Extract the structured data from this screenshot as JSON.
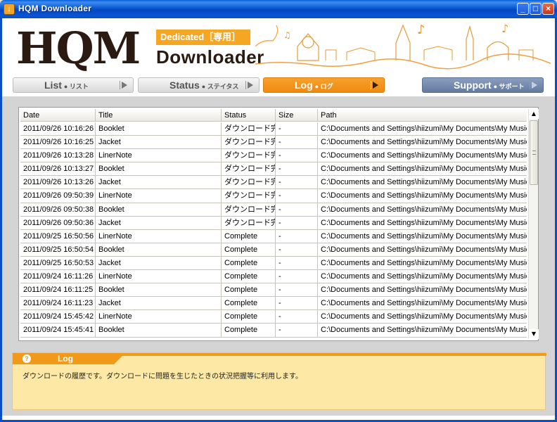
{
  "window": {
    "title": "HQM Downloader",
    "app_icon_glyph": "↓",
    "minimize_glyph": "_",
    "maximize_glyph": "□",
    "close_glyph": "×"
  },
  "header": {
    "logo": "HQM",
    "badge": "Dedicated［専用］",
    "subtitle": "Downloader"
  },
  "nav": {
    "tabs": [
      {
        "label": "List",
        "sub": "● リスト"
      },
      {
        "label": "Status",
        "sub": "● ステイタス"
      },
      {
        "label": "Log",
        "sub": "● ログ"
      },
      {
        "label": "Support",
        "sub": "● サポート"
      }
    ]
  },
  "table": {
    "columns": [
      "Date",
      "Title",
      "Status",
      "Size",
      "Path"
    ],
    "rows": [
      [
        "2011/09/26 10:16:26",
        "Booklet",
        "ダウンロード完了",
        "-",
        "C:\\Documents and Settings\\hiizumi\\My Documents\\My Music\\HQM\\HQ"
      ],
      [
        "2011/09/26 10:16:25",
        "Jacket",
        "ダウンロード完了",
        "-",
        "C:\\Documents and Settings\\hiizumi\\My Documents\\My Music\\HQM\\HQ"
      ],
      [
        "2011/09/26 10:13:28",
        "LinerNote",
        "ダウンロード完了",
        "-",
        "C:\\Documents and Settings\\hiizumi\\My Documents\\My Music\\HQM\\HQ"
      ],
      [
        "2011/09/26 10:13:27",
        "Booklet",
        "ダウンロード完了",
        "-",
        "C:\\Documents and Settings\\hiizumi\\My Documents\\My Music\\HQM\\HQ"
      ],
      [
        "2011/09/26 10:13:26",
        "Jacket",
        "ダウンロード完了",
        "-",
        "C:\\Documents and Settings\\hiizumi\\My Documents\\My Music\\HQM\\HQ"
      ],
      [
        "2011/09/26 09:50:39",
        "LinerNote",
        "ダウンロード完了",
        "-",
        "C:\\Documents and Settings\\hiizumi\\My Documents\\My Music\\HQM\\HQ"
      ],
      [
        "2011/09/26 09:50:38",
        "Booklet",
        "ダウンロード完了",
        "-",
        "C:\\Documents and Settings\\hiizumi\\My Documents\\My Music\\HQM\\HQ"
      ],
      [
        "2011/09/26 09:50:36",
        "Jacket",
        "ダウンロード完了",
        "-",
        "C:\\Documents and Settings\\hiizumi\\My Documents\\My Music\\HQM\\HQ"
      ],
      [
        "2011/09/25 16:50:56",
        "LinerNote",
        "Complete",
        "-",
        "C:\\Documents and Settings\\hiizumi\\My Documents\\My Music\\HQM\\HQ"
      ],
      [
        "2011/09/25 16:50:54",
        "Booklet",
        "Complete",
        "-",
        "C:\\Documents and Settings\\hiizumi\\My Documents\\My Music\\HQM\\HQ"
      ],
      [
        "2011/09/25 16:50:53",
        "Jacket",
        "Complete",
        "-",
        "C:\\Documents and Settings\\hiizumi\\My Documents\\My Music\\HQM\\HQ"
      ],
      [
        "2011/09/24 16:11:26",
        "LinerNote",
        "Complete",
        "-",
        "C:\\Documents and Settings\\hiizumi\\My Documents\\My Music\\HQM\\HQ"
      ],
      [
        "2011/09/24 16:11:25",
        "Booklet",
        "Complete",
        "-",
        "C:\\Documents and Settings\\hiizumi\\My Documents\\My Music\\HQM\\HQ"
      ],
      [
        "2011/09/24 16:11:23",
        "Jacket",
        "Complete",
        "-",
        "C:\\Documents and Settings\\hiizumi\\My Documents\\My Music\\HQM\\HQ"
      ],
      [
        "2011/09/24 15:45:42",
        "LinerNote",
        "Complete",
        "-",
        "C:\\Documents and Settings\\hiizumi\\My Documents\\My Music\\HQM\\HQ"
      ],
      [
        "2011/09/24 15:45:41",
        "Booklet",
        "Complete",
        "-",
        "C:\\Documents and Settings\\hiizumi\\My Documents\\My Music\\HQM\\HQ"
      ]
    ]
  },
  "log_panel": {
    "icon_glyph": "?",
    "title": "Log",
    "description": "ダウンロードの履歴です。ダウンロードに問題を生じたときの状況把握等に利用します。"
  },
  "colors": {
    "accent": "#f19a1a",
    "titlebar": "#0a4fc6",
    "support_tab": "#647aa0",
    "log_background": "#fde8a6"
  },
  "icons": [
    "app-icon",
    "download-icon",
    "play-arrow-icon",
    "help-icon",
    "scroll-up-icon",
    "scroll-down-icon"
  ]
}
